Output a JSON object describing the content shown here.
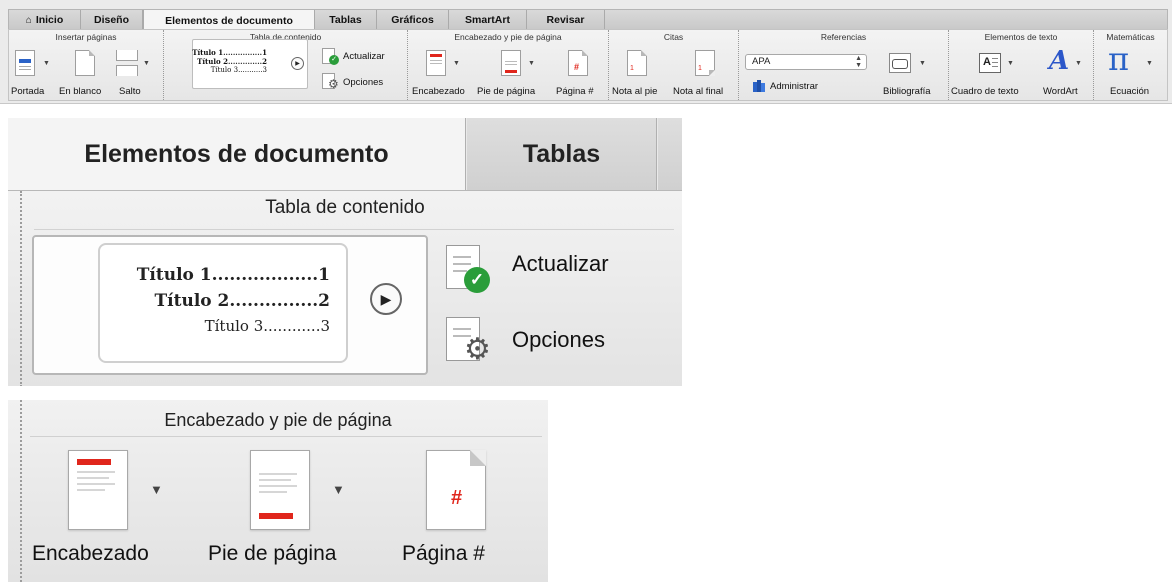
{
  "ribbon": {
    "tabs": [
      "Inicio",
      "Diseño",
      "Elementos de documento",
      "Tablas",
      "Gráficos",
      "SmartArt",
      "Revisar"
    ],
    "groups": {
      "insertar_paginas": {
        "title": "Insertar páginas",
        "portada": "Portada",
        "en_blanco": "En blanco",
        "salto": "Salto"
      },
      "tabla_contenido": {
        "title": "Tabla de contenido",
        "toc_lines": [
          "Título 1................1",
          "Título 2..............2",
          "Título 3...........3"
        ],
        "actualizar": "Actualizar",
        "opciones": "Opciones"
      },
      "encabezado_pie": {
        "title": "Encabezado y pie de página",
        "encabezado": "Encabezado",
        "pie": "Pie de página",
        "pagina": "Página #",
        "hash": "#"
      },
      "citas": {
        "title": "Citas",
        "nota_pie": "Nota al pie",
        "nota_final": "Nota al final",
        "marker": "1"
      },
      "referencias": {
        "title": "Referencias",
        "style": "APA",
        "administrar": "Administrar",
        "bibliografia": "Bibliografía"
      },
      "elementos_texto": {
        "title": "Elementos de texto",
        "cuadro": "Cuadro de texto",
        "wordart": "WordArt",
        "wordart_glyph": "A"
      },
      "matematicas": {
        "title": "Matemáticas",
        "ecuacion": "Ecuación",
        "pi_glyph": "π"
      }
    }
  },
  "zoom_toc": {
    "tabs": [
      "Elementos de documento",
      "Tablas"
    ],
    "group_title": "Tabla de contenido",
    "toc_lines": [
      "Título 1..................1",
      "Título 2...............2",
      "Título 3............3"
    ],
    "actualizar": "Actualizar",
    "opciones": "Opciones"
  },
  "zoom_hf": {
    "group_title": "Encabezado y pie de página",
    "encabezado": "Encabezado",
    "pie": "Pie de página",
    "pagina": "Página #",
    "hash": "#"
  },
  "colors": {
    "red": "#e0261c",
    "green": "#2a9d3a",
    "blue": "#2a62c7",
    "wordart_blue": "#2b56c9"
  }
}
